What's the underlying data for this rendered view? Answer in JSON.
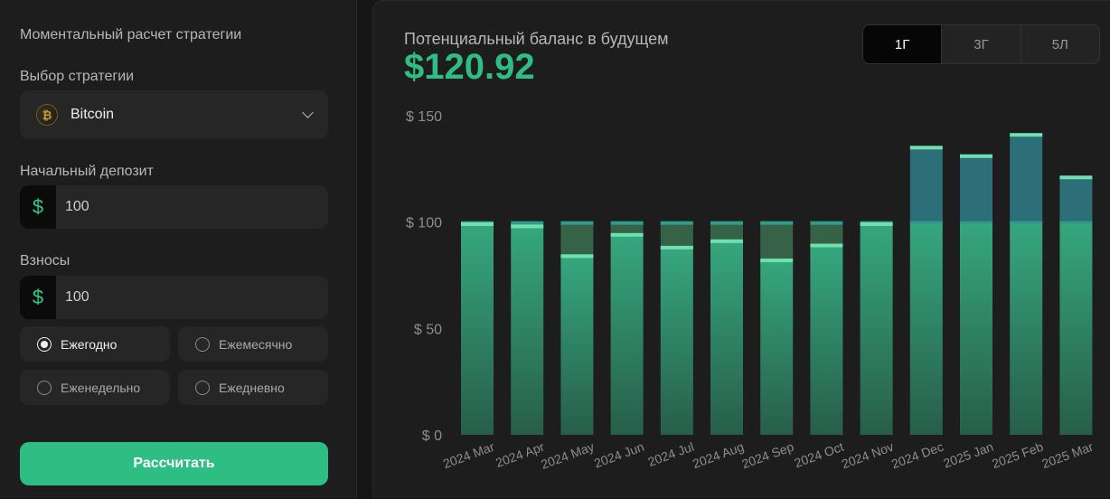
{
  "left": {
    "title": "Моментальный расчет стратегии",
    "strategy_label": "Выбор стратегии",
    "strategy_value": "Bitcoin",
    "strategy_icon": "bitcoin-icon",
    "deposit_label": "Начальный депозит",
    "deposit_value": "100",
    "contrib_label": "Взносы",
    "contrib_value": "100",
    "currency_symbol": "$",
    "frequency_options": [
      "Ежегодно",
      "Ежемесячно",
      "Еженедельно",
      "Ежедневно"
    ],
    "frequency_selected": "Ежегодно",
    "calculate_label": "Рассчитать"
  },
  "right": {
    "balance_label": "Потенциальный баланс в будущем",
    "balance_value": "$120.92",
    "periods": [
      "1Г",
      "3Г",
      "5Л"
    ],
    "period_selected": "1Г"
  },
  "colors": {
    "accent": "#2ebd82",
    "bar_base": "#2f8f6e",
    "bar_gain": "#2c6f78",
    "bar_loss": "#3a6b4e"
  },
  "chart_data": {
    "type": "bar",
    "categories": [
      "2024 Mar",
      "2024 Apr",
      "2024 May",
      "2024 Jun",
      "2024 Jul",
      "2024 Aug",
      "2024 Sep",
      "2024 Oct",
      "2024 Nov",
      "2024 Dec",
      "2025 Jan",
      "2025 Feb",
      "2025 Mar"
    ],
    "series": [
      {
        "values": [
          99,
          98,
          84,
          94,
          88,
          91,
          82,
          89,
          99,
          135,
          131,
          141,
          121
        ]
      }
    ],
    "baseline": 100,
    "ylim": [
      0,
      150
    ],
    "yticks": [
      0,
      50,
      100,
      150
    ],
    "ytick_labels": [
      "$ 0",
      "$ 50",
      "$ 100",
      "$ 150"
    ],
    "grid": false,
    "legend": "none"
  }
}
